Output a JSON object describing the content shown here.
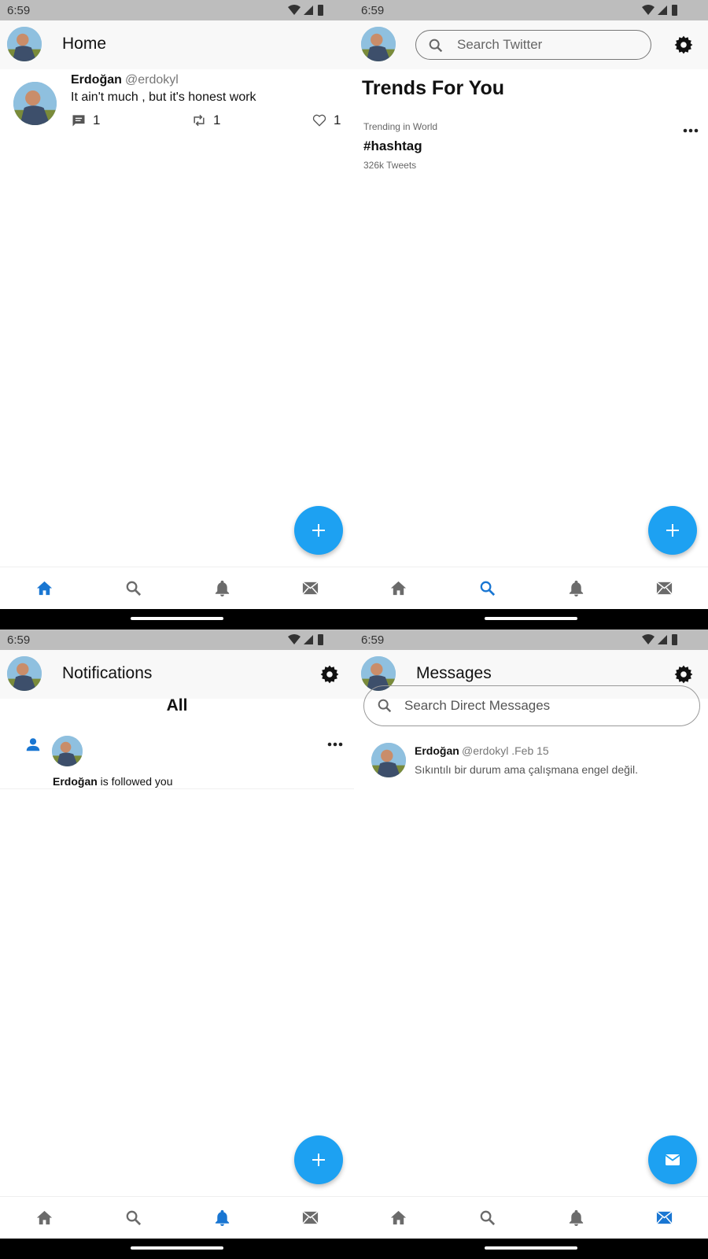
{
  "status_bar": {
    "time": "6:59"
  },
  "colors": {
    "accent": "#1da1f2",
    "active_nav": "#1976d2",
    "inactive_nav": "#6b6b6b"
  },
  "home": {
    "title": "Home",
    "tweet": {
      "name": "Erdoğan",
      "handle": "@erdokyl",
      "text": "It ain't much , but it's honest work",
      "replies": "1",
      "retweets": "1",
      "likes": "1"
    }
  },
  "search": {
    "placeholder": "Search Twitter",
    "section_title": "Trends For You",
    "trend": {
      "category": "Trending in World",
      "tag": "#hashtag",
      "count": "326k Tweets"
    }
  },
  "notifications": {
    "title": "Notifications",
    "tab": "All",
    "item": {
      "name": "Erdoğan",
      "action": " is followed you"
    }
  },
  "messages": {
    "title": "Messages",
    "search_placeholder": "Search Direct Messages",
    "conversation": {
      "name": "Erdoğan",
      "meta": "@erdokyl .Feb 15",
      "preview": "Sıkıntılı bir durum ama çalışmana engel değil."
    }
  },
  "nav_icons": [
    "home-icon",
    "search-icon",
    "bell-icon",
    "mail-icon"
  ]
}
